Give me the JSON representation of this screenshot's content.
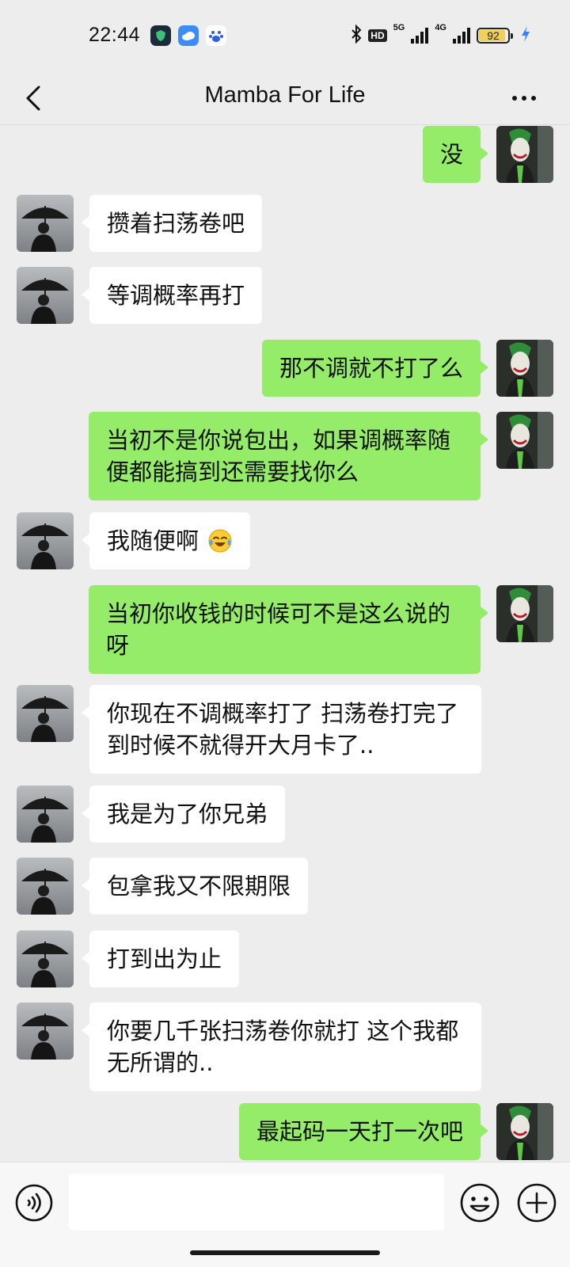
{
  "status_bar": {
    "time": "22:44",
    "hd_label": "HD",
    "net1_label": "5G",
    "net2_label": "4G",
    "battery_level": "92",
    "battery_fraction": 0.92,
    "battery_color": "#f2cf5b"
  },
  "header": {
    "title": "Mamba For Life",
    "back_icon": "chevron-left-icon",
    "more_icon": "more-dots-icon"
  },
  "colors": {
    "background": "#ededed",
    "sent_bubble": "#95ec69",
    "received_bubble": "#ffffff"
  },
  "messages": [
    {
      "side": "right",
      "text": "没"
    },
    {
      "side": "left",
      "text": "攒着扫荡卷吧"
    },
    {
      "side": "left",
      "text": "等调概率再打"
    },
    {
      "side": "right",
      "text": "那不调就不打了么"
    },
    {
      "side": "right",
      "text": "当初不是你说包出，如果调概率随便都能搞到还需要找你么"
    },
    {
      "side": "left",
      "text": "我随便啊",
      "emoji": "crying-laughing-emoji"
    },
    {
      "side": "right",
      "text": "当初你收钱的时候可不是这么说的呀"
    },
    {
      "side": "left",
      "text": "你现在不调概率打了 扫荡卷打完了 到时候不就得开大月卡了.."
    },
    {
      "side": "left",
      "text": "我是为了你兄弟"
    },
    {
      "side": "left",
      "text": "包拿我又不限期限"
    },
    {
      "side": "left",
      "text": "打到出为止"
    },
    {
      "side": "left",
      "text": "你要几千张扫荡卷你就打 这个我都无所谓的.."
    },
    {
      "side": "right",
      "text": "最起码一天打一次吧"
    }
  ],
  "input_bar": {
    "value": "",
    "voice_icon": "voice-icon",
    "emoji_icon": "emoji-icon",
    "plus_icon": "plus-icon"
  }
}
